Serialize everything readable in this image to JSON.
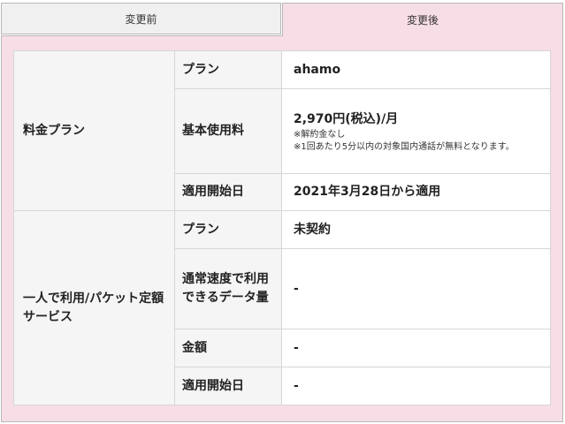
{
  "tabs": {
    "before": "変更前",
    "after": "変更後"
  },
  "sections": [
    {
      "group": "料金プラン",
      "rows": [
        {
          "label": "プラン",
          "value": "ahamo"
        },
        {
          "label": "基本使用料",
          "value": "2,970円(税込)/月",
          "notes": [
            "※解約金なし",
            "※1回あたり5分以内の対象国内通話が無料となります。"
          ]
        },
        {
          "label": "適用開始日",
          "value": "2021年3月28日から適用"
        }
      ]
    },
    {
      "group": "一人で利用/パケット定額サービス",
      "rows": [
        {
          "label": "プラン",
          "value": "未契約"
        },
        {
          "label": "通常速度で利用できるデータ量",
          "value": "-"
        },
        {
          "label": "金額",
          "value": "-"
        },
        {
          "label": "適用開始日",
          "value": "-"
        }
      ]
    }
  ]
}
